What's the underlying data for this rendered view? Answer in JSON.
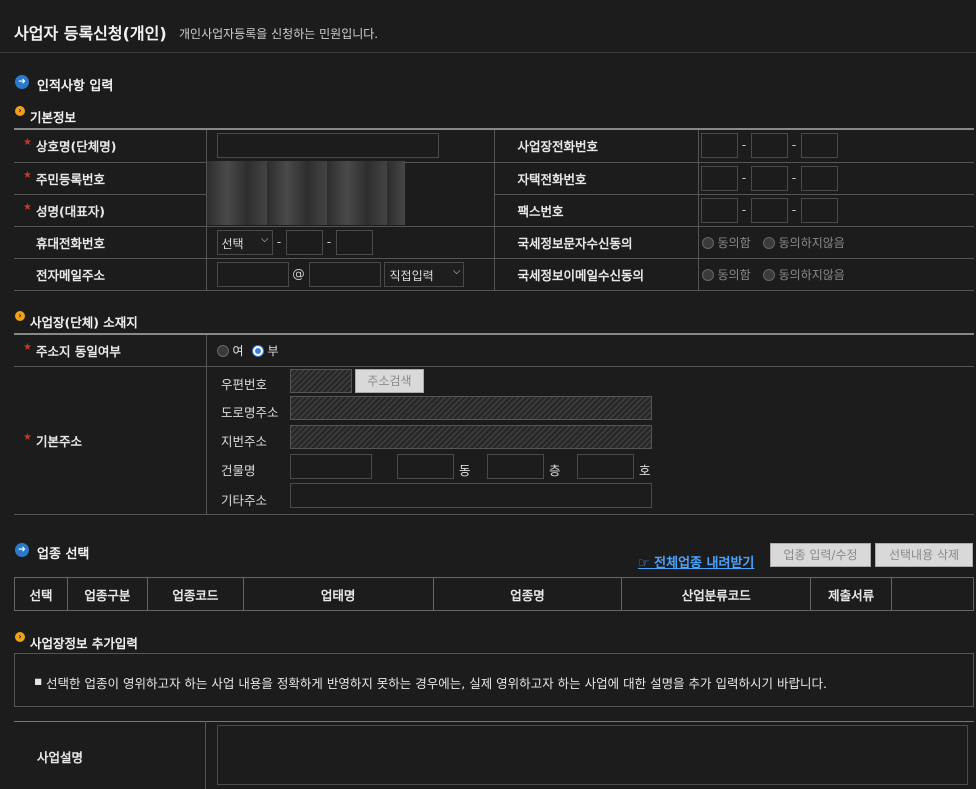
{
  "header": {
    "title": "사업자 등록신청(개인)",
    "subtitle": "개인사업자등록을 신청하는 민원입니다."
  },
  "section_personal": {
    "title": "인적사항 입력",
    "subsection": "기본정보",
    "labels": {
      "company_name": "상호명(단체명)",
      "resident_no": "주민등록번호",
      "name": "성명(대표자)",
      "mobile": "휴대전화번호",
      "email": "전자메일주소",
      "biz_phone": "사업장전화번호",
      "home_phone": "자택전화번호",
      "fax": "팩스번호",
      "sms_consent": "국세정보문자수신동의",
      "email_consent": "국세정보이메일수신동의"
    },
    "mobile_select": "선택",
    "email_at": "@",
    "email_domain_select": "직접입력",
    "dash": "-",
    "consent_yes": "동의함",
    "consent_no": "동의하지않음"
  },
  "section_location": {
    "subsection": "사업장(단체) 소재지",
    "same_address_label": "주소지 동일여부",
    "opt_yes": "여",
    "opt_no": "부",
    "basic_address_label": "기본주소",
    "zip_label": "우편번호",
    "search_button": "주소검색",
    "road_label": "도로명주소",
    "lot_label": "지번주소",
    "building_label": "건물명",
    "dong": "동",
    "floor": "층",
    "ho": "호",
    "other_label": "기타주소"
  },
  "section_business": {
    "title": "업종 선택",
    "download_link": "☞ 전체업종 내려받기",
    "edit_button": "업종 입력/수정",
    "delete_button": "선택내용 삭제",
    "columns": [
      "선택",
      "업종구분",
      "업종코드",
      "업태명",
      "업종명",
      "산업분류코드",
      "제출서류",
      ""
    ]
  },
  "section_extra": {
    "subsection": "사업장정보 추가입력",
    "notice": "선택한 업종이 영위하고자 하는 사업 내용을 정확하게 반영하지 못하는 경우에는, 실제 영위하고자 하는 사업에 대한 설명을 추가 입력하시기 바랍니다.",
    "desc_label": "사업설명"
  }
}
